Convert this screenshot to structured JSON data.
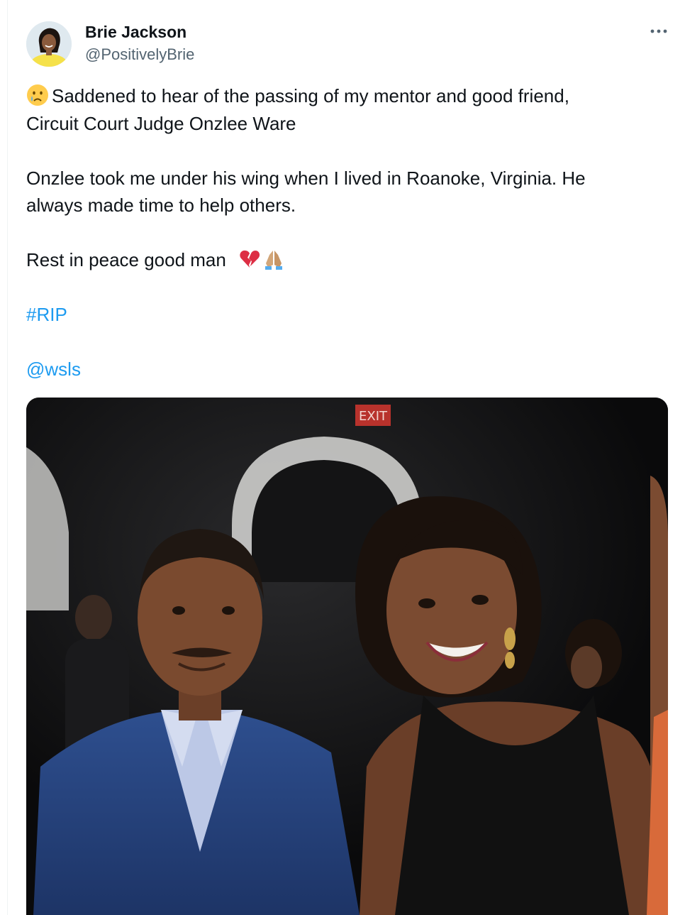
{
  "author": {
    "name": "Brie Jackson",
    "handle": "@PositivelyBrie"
  },
  "icons": {
    "avatar": "profile-photo",
    "more": "more-horizontal-icon",
    "crying": "crying-face-emoji",
    "broken_heart": "broken-heart-emoji",
    "praying": "folded-hands-emoji"
  },
  "tweet": {
    "line1": "Saddened to hear of the passing of my mentor and good friend,",
    "line2": "Circuit Court Judge Onzlee Ware",
    "line3": "Onzlee took me under his wing when I lived in Roanoke, Virginia. He",
    "line4": "always made time to help others.",
    "line5": "Rest in peace good man",
    "hashtag": "#RIP",
    "mention": "@wsls"
  },
  "media": {
    "exit_sign": "EXIT"
  },
  "colors": {
    "link": "#1d9bf0",
    "secondary_text": "#536471",
    "primary_text": "#0f1419"
  }
}
